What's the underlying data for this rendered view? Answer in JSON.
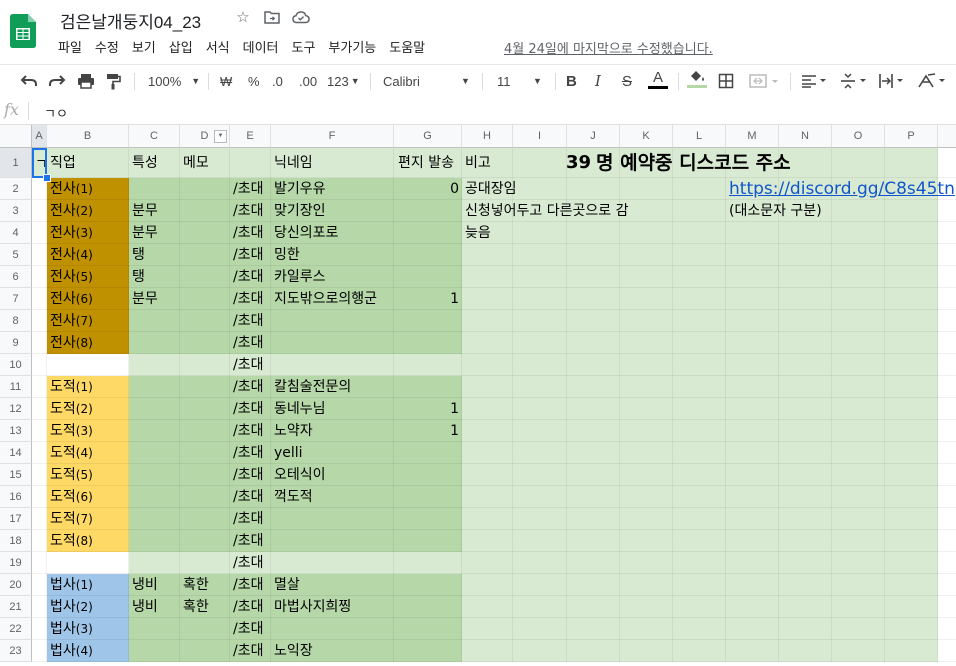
{
  "doc": {
    "title": "검은날개둥지04_23",
    "menu": [
      "파일",
      "수정",
      "보기",
      "삽입",
      "서식",
      "데이터",
      "도구",
      "부가기능",
      "도움말"
    ],
    "last_edit": "4월 24일에 마지막으로 수정했습니다."
  },
  "toolbar": {
    "zoom": "100%",
    "currency": "₩",
    "percent": "%",
    "dec_less": ".0",
    "dec_more": ".00",
    "format": "123",
    "font": "Calibri",
    "font_size": "11",
    "bold": "B",
    "italic": "I",
    "strike": "S",
    "text_color": "A"
  },
  "formula": {
    "fx": "fx",
    "value": "ㄱㅇ"
  },
  "columns": [
    "A",
    "B",
    "C",
    "D",
    "E",
    "F",
    "G",
    "H",
    "I",
    "J",
    "K",
    "L",
    "M",
    "N",
    "O",
    "P"
  ],
  "rows": [
    "1",
    "2",
    "3",
    "4",
    "5",
    "6",
    "7",
    "8",
    "9",
    "10",
    "11",
    "12",
    "13",
    "14",
    "15",
    "16",
    "17",
    "18",
    "19",
    "20",
    "21",
    "22",
    "23"
  ],
  "header_row": {
    "a": "ㄱ",
    "job": "직업",
    "trait": "특성",
    "memo": "메모",
    "nickname": "닉네임",
    "letter": "편지 발송",
    "note": "비고",
    "reserve_count": "39",
    "reserve_label": "명 예약중 디스코드 주소"
  },
  "data_rows": [
    {
      "job": "전사",
      "num": "(1)",
      "trait": "",
      "memo": "",
      "invite": "/초대",
      "nick": "발기우유",
      "letter": "0",
      "note": "공대장임"
    },
    {
      "job": "전사",
      "num": "(2)",
      "trait": "분무",
      "memo": "",
      "invite": "/초대",
      "nick": "맞기장인",
      "letter": "",
      "note": "신청넣어두고 다른곳으로 감"
    },
    {
      "job": "전사",
      "num": "(3)",
      "trait": "분무",
      "memo": "",
      "invite": "/초대",
      "nick": "당신의포로",
      "letter": "",
      "note": "늦음"
    },
    {
      "job": "전사",
      "num": "(4)",
      "trait": "탱",
      "memo": "",
      "invite": "/초대",
      "nick": "밍한",
      "letter": "",
      "note": ""
    },
    {
      "job": "전사",
      "num": "(5)",
      "trait": "탱",
      "memo": "",
      "invite": "/초대",
      "nick": "카일루스",
      "letter": "",
      "note": ""
    },
    {
      "job": "전사",
      "num": "(6)",
      "trait": "분무",
      "memo": "",
      "invite": "/초대",
      "nick": "지도밖으로의행군",
      "letter": "1",
      "note": ""
    },
    {
      "job": "전사",
      "num": "(7)",
      "trait": "",
      "memo": "",
      "invite": "/초대",
      "nick": "",
      "letter": "",
      "note": ""
    },
    {
      "job": "전사",
      "num": "(8)",
      "trait": "",
      "memo": "",
      "invite": "/초대",
      "nick": "",
      "letter": "",
      "note": ""
    },
    {
      "job": "",
      "num": "",
      "trait": "",
      "memo": "",
      "invite": "/초대",
      "nick": "",
      "letter": "",
      "note": ""
    },
    {
      "job": "도적",
      "num": "(1)",
      "trait": "",
      "memo": "",
      "invite": "/초대",
      "nick": "칼침술전문의",
      "letter": "",
      "note": ""
    },
    {
      "job": "도적",
      "num": "(2)",
      "trait": "",
      "memo": "",
      "invite": "/초대",
      "nick": "동네누님",
      "letter": "1",
      "note": ""
    },
    {
      "job": "도적",
      "num": "(3)",
      "trait": "",
      "memo": "",
      "invite": "/초대",
      "nick": "노약자",
      "letter": "1",
      "note": ""
    },
    {
      "job": "도적",
      "num": "(4)",
      "trait": "",
      "memo": "",
      "invite": "/초대",
      "nick": "yelli",
      "letter": "",
      "note": ""
    },
    {
      "job": "도적",
      "num": "(5)",
      "trait": "",
      "memo": "",
      "invite": "/초대",
      "nick": "오테식이",
      "letter": "",
      "note": ""
    },
    {
      "job": "도적",
      "num": "(6)",
      "trait": "",
      "memo": "",
      "invite": "/초대",
      "nick": "꺽도적",
      "letter": "",
      "note": ""
    },
    {
      "job": "도적",
      "num": "(7)",
      "trait": "",
      "memo": "",
      "invite": "/초대",
      "nick": "",
      "letter": "",
      "note": ""
    },
    {
      "job": "도적",
      "num": "(8)",
      "trait": "",
      "memo": "",
      "invite": "/초대",
      "nick": "",
      "letter": "",
      "note": ""
    },
    {
      "job": "",
      "num": "",
      "trait": "",
      "memo": "",
      "invite": "/초대",
      "nick": "",
      "letter": "",
      "note": ""
    },
    {
      "job": "법사",
      "num": "(1)",
      "trait": "냉비",
      "memo": "혹한",
      "invite": "/초대",
      "nick": "멸살",
      "letter": "",
      "note": ""
    },
    {
      "job": "법사",
      "num": "(2)",
      "trait": "냉비",
      "memo": "혹한",
      "invite": "/초대",
      "nick": "마법사지희찡",
      "letter": "",
      "note": ""
    },
    {
      "job": "법사",
      "num": "(3)",
      "trait": "",
      "memo": "",
      "invite": "/초대",
      "nick": "",
      "letter": "",
      "note": ""
    },
    {
      "job": "법사",
      "num": "(4)",
      "trait": "",
      "memo": "",
      "invite": "/초대",
      "nick": "노익장",
      "letter": "",
      "note": ""
    }
  ],
  "discord": {
    "url": "https://discord.gg/C8s45tn",
    "note": "(대소문자 구분)"
  },
  "colors": {
    "warrior": "#bf9000",
    "rogue": "#ffd966",
    "mage": "#9fc5e8",
    "green_mid": "#b6d7a8",
    "green_light": "#d9ead3",
    "link": "#1155cc"
  }
}
